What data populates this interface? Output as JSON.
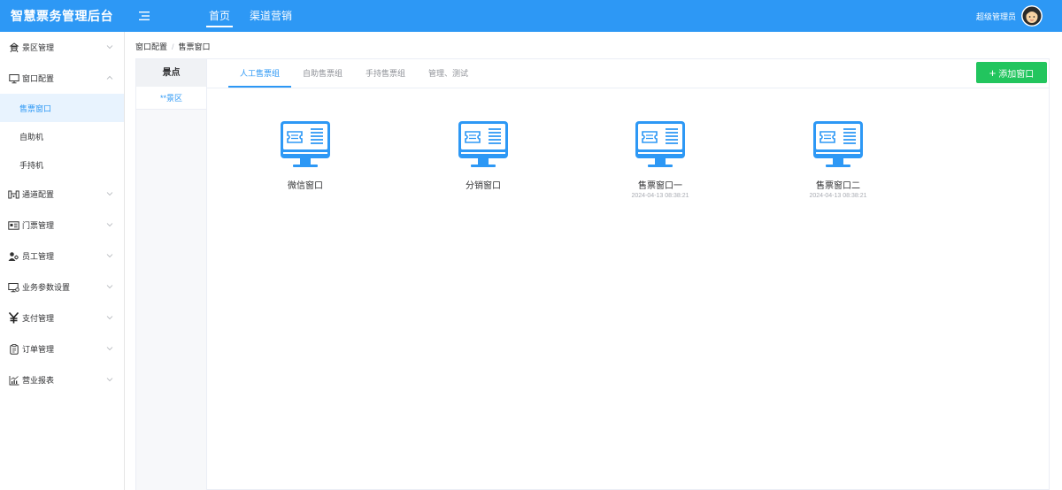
{
  "app": {
    "title": "智慧票务管理后台"
  },
  "colors": {
    "primary": "#2d98f5",
    "success": "#22c55e"
  },
  "top_nav": [
    {
      "label": "首页",
      "active": true
    },
    {
      "label": "渠道营销",
      "active": false
    }
  ],
  "user": {
    "name": "超级管理员"
  },
  "sidebar": {
    "items": [
      {
        "label": "景区管理",
        "icon": "scenic-icon"
      },
      {
        "label": "窗口配置",
        "icon": "monitor-icon",
        "expanded": true,
        "children": [
          {
            "label": "售票窗口",
            "active": true
          },
          {
            "label": "自助机",
            "active": false
          },
          {
            "label": "手持机",
            "active": false
          }
        ]
      },
      {
        "label": "通道配置",
        "icon": "gate-icon"
      },
      {
        "label": "门票管理",
        "icon": "ticket-icon"
      },
      {
        "label": "员工管理",
        "icon": "staff-icon"
      },
      {
        "label": "业务参数设置",
        "icon": "settings-monitor-icon"
      },
      {
        "label": "支付管理",
        "icon": "yen-icon"
      },
      {
        "label": "订单管理",
        "icon": "order-icon"
      },
      {
        "label": "营业报表",
        "icon": "report-icon"
      }
    ]
  },
  "breadcrumb": [
    "窗口配置",
    "售票窗口"
  ],
  "scenic": {
    "header": "景点",
    "items": [
      "**景区"
    ]
  },
  "tabs": [
    {
      "label": "人工售票组",
      "active": true
    },
    {
      "label": "自助售票组",
      "active": false
    },
    {
      "label": "手持售票组",
      "active": false
    },
    {
      "label": "管理、测试",
      "active": false
    }
  ],
  "add_button": {
    "label": "添加窗口"
  },
  "windows": [
    {
      "name": "微信窗口",
      "time": ""
    },
    {
      "name": "分销窗口",
      "time": ""
    },
    {
      "name": "售票窗口一",
      "time": "2024-04-13 08:38:21"
    },
    {
      "name": "售票窗口二",
      "time": "2024-04-13 08:38:21"
    }
  ]
}
